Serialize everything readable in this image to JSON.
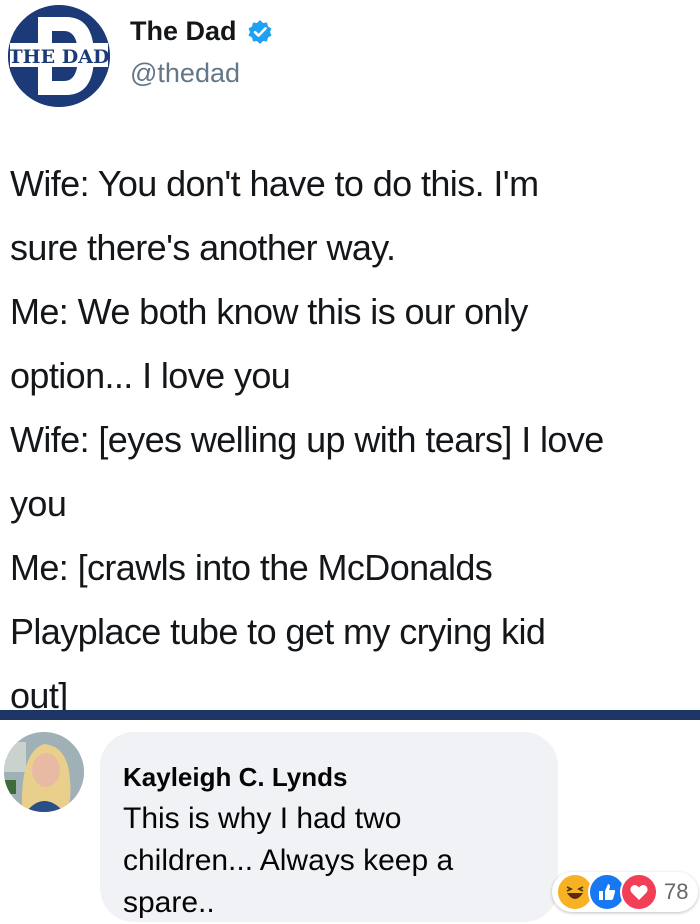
{
  "tweet": {
    "logo_text": "THE DAD",
    "author_name": "The Dad",
    "author_handle": "@thedad",
    "text_lines": [
      "Wife: You don't have to do this. I'm",
      "sure there's another way.",
      "Me: We both know this is our only",
      "option... I love you",
      "Wife: [eyes welling up with tears] I love",
      "you",
      "Me: [crawls into the McDonalds",
      "Playplace tube to get my crying kid",
      "out]"
    ]
  },
  "comment": {
    "author": "Kayleigh C. Lynds",
    "text_lines": [
      "This is why I had two",
      "children... Always keep a",
      "spare.."
    ],
    "reactions": [
      "haha",
      "like",
      "love"
    ],
    "reaction_count": "78"
  },
  "colors": {
    "logo_blue": "#1d3a78",
    "verified_blue": "#1da1f2",
    "divider": "#1c3563",
    "bubble": "#f0f2f5",
    "like_blue": "#1877f2",
    "love_red": "#f33e58",
    "haha_yellow": "#f7b125"
  }
}
